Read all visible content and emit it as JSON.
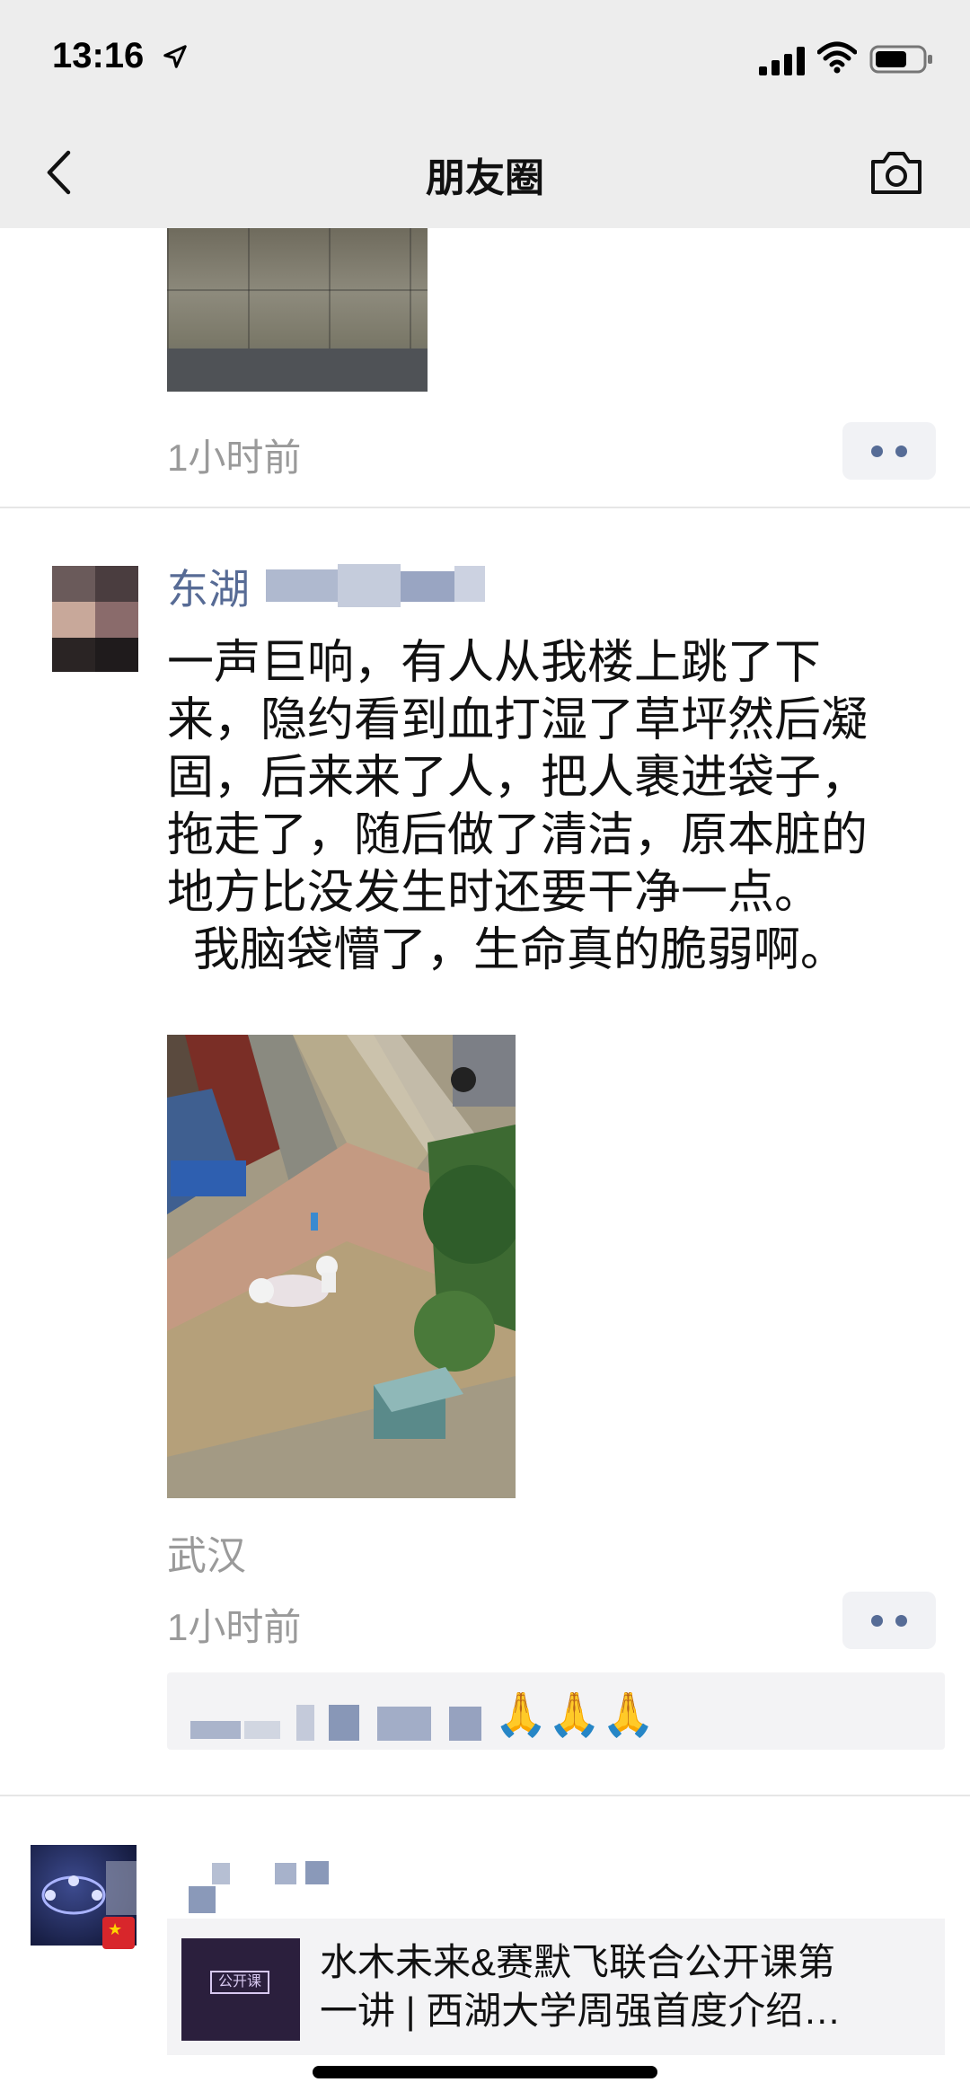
{
  "status_bar": {
    "time": "13:16",
    "icons": [
      "location-arrow-icon",
      "cellular-signal-icon",
      "wifi-icon",
      "battery-icon"
    ]
  },
  "nav": {
    "title": "朋友圈",
    "back_icon": "chevron-left-icon",
    "camera_icon": "camera-icon"
  },
  "previous_post": {
    "time_label": "1小时前"
  },
  "post": {
    "author_visible": "东湖",
    "text_lines": [
      "一声巨响，有人从我楼上跳了下",
      "来，隐约看到血打湿了草坪然后凝",
      "固，后来来了人，把人裹进袋子，",
      "拖走了，随后做了清洁，原本脏的",
      "地方比没发生时还要干净一点。",
      "  我脑袋懵了，生命真的脆弱啊。"
    ],
    "location": "武汉",
    "time_label": "1小时前",
    "comment_emoji": "🙏🙏🙏"
  },
  "next_post": {
    "link_thumb_badge": "公开课",
    "link_title_line1": "水木未来&赛默飞联合公开课第",
    "link_title_line2": "一讲 | 西湖大学周强首度介绍…"
  },
  "colors": {
    "nav_bg": "#ededed",
    "author_link": "#576b95",
    "meta_gray": "#9a9a9a",
    "comment_bg": "#f3f3f5"
  }
}
